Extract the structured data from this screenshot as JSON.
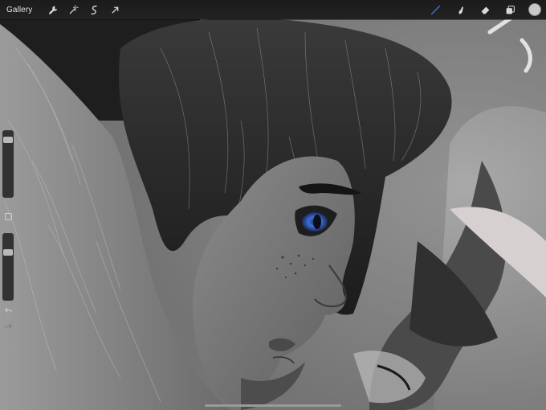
{
  "toolbar": {
    "gallery_label": "Gallery",
    "left_icons": [
      "wrench-icon",
      "magic-wand-icon",
      "selection-icon",
      "transform-arrow-icon"
    ],
    "right_icons": [
      "brush-icon",
      "smudge-icon",
      "eraser-icon",
      "layers-icon"
    ],
    "active_tool": "brush",
    "active_color": "#3b6fd8"
  },
  "current_color": "#c8c8c8",
  "sidebar": {
    "brush_size": 0.9,
    "opacity": 0.75,
    "icons": [
      "modify-square-icon",
      "undo-icon",
      "redo-icon"
    ]
  }
}
